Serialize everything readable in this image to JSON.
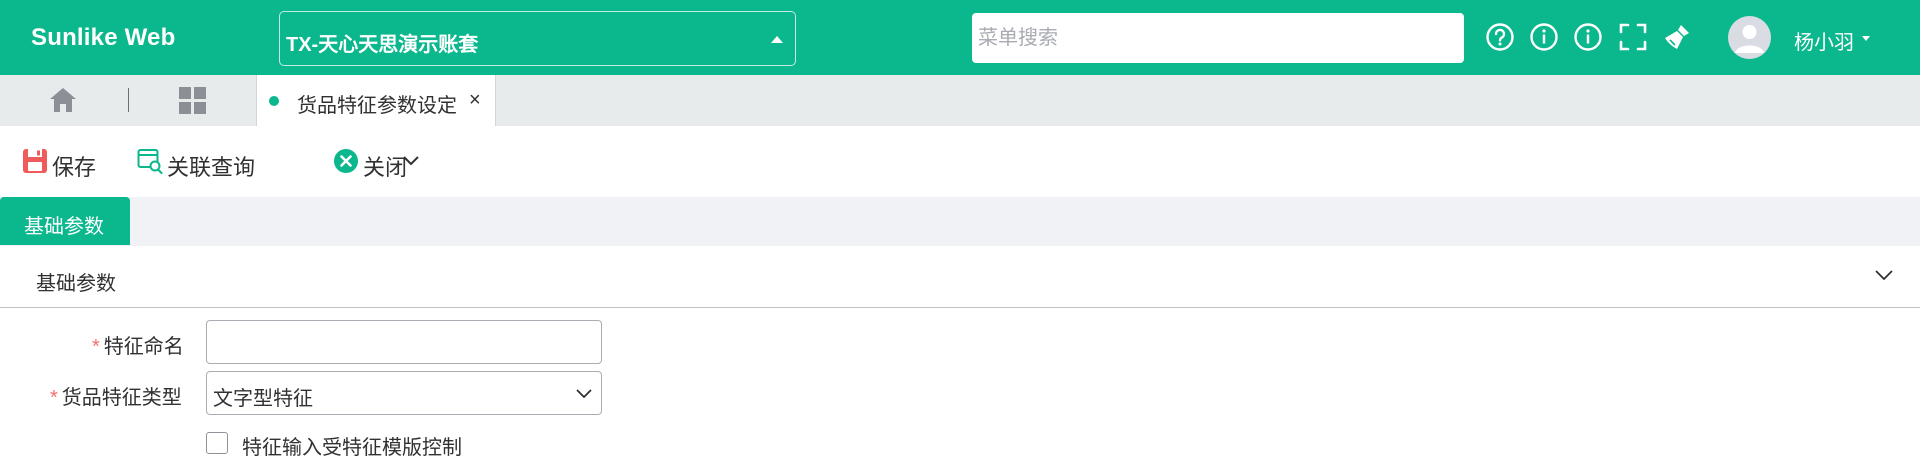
{
  "header": {
    "brand": "Sunlike Web",
    "account": "TX-天心天思演示账套",
    "search_placeholder": "菜单搜索",
    "user_name": "杨小羽"
  },
  "tabs": {
    "active_label": "货品特征参数设定",
    "close_glyph": "×"
  },
  "toolbar": {
    "save_label": "保存",
    "related_label": "关联查询",
    "close_label": "关闭"
  },
  "section": {
    "tab_label": "基础参数",
    "collapse_title": "基础参数"
  },
  "form": {
    "required_mark": "*",
    "name_label": "特征命名",
    "name_value": "",
    "type_label": "货品特征类型",
    "type_value": "文字型特征",
    "template_checkbox_label": "特征输入受特征模版控制",
    "template_checked": false
  },
  "colors": {
    "brand": "#0bb78c",
    "required": "#f56c6c",
    "save_icon": "#ef5b5b"
  },
  "icons": {
    "top_right": [
      "help-icon",
      "info-icon",
      "info-icon",
      "fullscreen-icon",
      "broom-icon"
    ],
    "tabstrip": [
      "home-icon",
      "apps-grid-icon"
    ],
    "toolbar": [
      "save-icon",
      "related-query-icon",
      "chevron-down-icon",
      "close-circle-icon"
    ]
  }
}
